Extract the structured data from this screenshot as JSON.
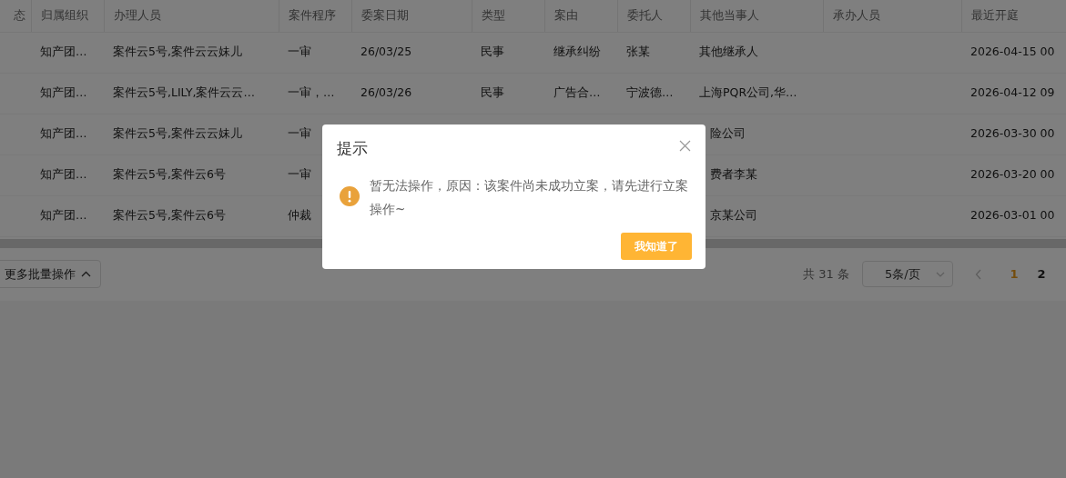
{
  "table": {
    "columns": [
      "态",
      "归属组织",
      "办理人员",
      "案件程序",
      "委案日期",
      "类型",
      "案由",
      "委托人",
      "其他当事人",
      "承办人员",
      "最近开庭"
    ],
    "rows": [
      {
        "cells": [
          "",
          "知产团…",
          "案件云5号,案件云云妹儿",
          "一审",
          "26/03/25",
          "民事",
          "继承纠纷",
          "张某",
          "其他继承人",
          "",
          "2026-04-15 00"
        ]
      },
      {
        "cells": [
          "",
          "知产团…",
          "案件云5号,LILY,案件云云…",
          "一审，…",
          "26/03/26",
          "民事",
          "广告合…",
          "宁波德…",
          "上海PQR公司,华…",
          "",
          "2026-04-12 09"
        ]
      },
      {
        "cells": [
          "",
          "知产团…",
          "案件云5号,案件云云妹儿",
          "一审",
          "",
          "",
          "",
          "",
          "险公司",
          "",
          "2026-03-30 00"
        ]
      },
      {
        "cells": [
          "",
          "知产团…",
          "案件云5号,案件云6号",
          "一审",
          "",
          "",
          "",
          "",
          "费者李某",
          "",
          "2026-03-20 00"
        ]
      },
      {
        "cells": [
          "",
          "知产团…",
          "案件云5号,案件云6号",
          "仲裁",
          "",
          "",
          "",
          "",
          "京某公司",
          "",
          "2026-03-01 00"
        ]
      }
    ]
  },
  "footer": {
    "batch_button": "更多批量操作",
    "total": "共 31 条",
    "page_size": "5条/页",
    "pages": [
      {
        "label": "1",
        "selected": true
      },
      {
        "label": "2",
        "selected": false
      }
    ]
  },
  "dialog": {
    "title": "提示",
    "message": "暂无法操作，原因：该案件尚未成功立案，请先进行立案操作~",
    "button": "我知道了"
  }
}
